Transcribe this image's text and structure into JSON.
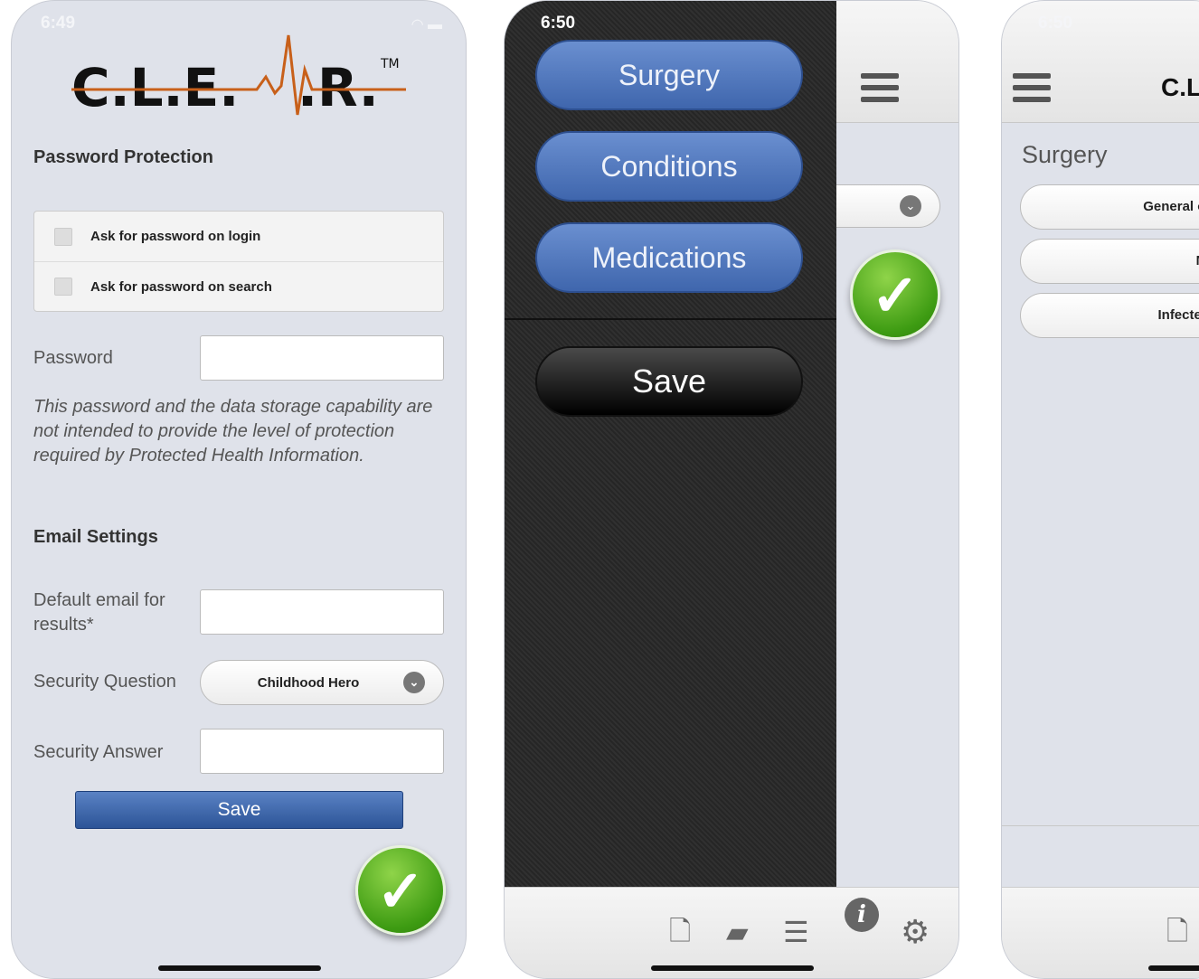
{
  "screen1": {
    "status_time": "6:49",
    "logo_text": "C.L.E.A.R.",
    "logo_tm": "TM",
    "password_section_title": "Password Protection",
    "checkboxes": [
      {
        "label": "Ask for password on login",
        "checked": false
      },
      {
        "label": "Ask for password on search",
        "checked": false
      }
    ],
    "password_label": "Password",
    "password_value": "",
    "note": "This password and the data storage capability are not intended to provide the level of protection required by Protected Health Information.",
    "email_section_title": "Email Settings",
    "default_email_label": "Default email for results*",
    "default_email_value": "",
    "security_question_label": "Security Question",
    "security_question_value": "Childhood Hero",
    "security_answer_label": "Security Answer",
    "security_answer_value": "",
    "save_label": "Save",
    "check_icon": "checkmark-icon"
  },
  "screen2": {
    "status_time": "6:50",
    "menu_items": [
      "Surgery",
      "Conditions",
      "Medications"
    ],
    "save_label": "Save",
    "tab_icons": [
      "new-document-icon",
      "folder-icon",
      "books-icon",
      "info-icon",
      "gear-icon"
    ]
  },
  "screen3": {
    "status_time": "6:50",
    "section_title": "Surgery",
    "items": [
      "General or v",
      "Minor",
      "Infected s"
    ]
  },
  "colors": {
    "accent_blue": "#3f66ad",
    "check_green": "#3d9b12",
    "logo_orange": "#c8601a"
  }
}
